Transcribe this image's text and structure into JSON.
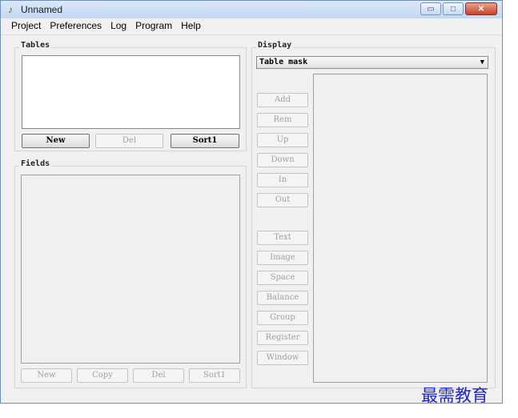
{
  "window": {
    "title": "Unnamed",
    "title_icon": "app-icon",
    "controls": {
      "minimize": "▭",
      "maximize": "□",
      "close": "✕"
    }
  },
  "menu": [
    "Project",
    "Preferences",
    "Log",
    "Program",
    "Help"
  ],
  "tables": {
    "label": "Tables",
    "buttons": {
      "new": "New",
      "del": "Del",
      "sort": "Sort1"
    }
  },
  "fields": {
    "label": "Fields",
    "buttons": {
      "new": "New",
      "copy": "Copy",
      "del": "Del",
      "sort": "Sort1"
    }
  },
  "display": {
    "label": "Display",
    "selected": "Table mask",
    "buttons": [
      "Add",
      "Rem",
      "Up",
      "Down",
      "In",
      "Out",
      "Text",
      "Image",
      "Space",
      "Balance",
      "Group",
      "Register",
      "Window"
    ]
  },
  "watermark": "最需教育"
}
